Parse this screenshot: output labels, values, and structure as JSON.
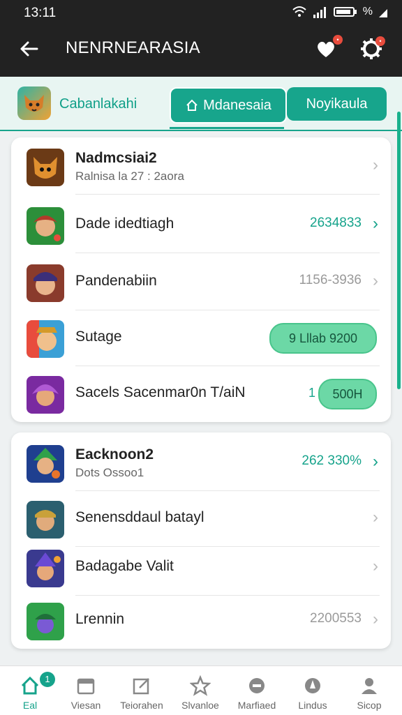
{
  "status": {
    "time": "13:11",
    "battery": "%"
  },
  "appbar": {
    "title": "NENRNEARASIA"
  },
  "tabs": {
    "brand_label": "Cabanlakahi",
    "tab1": "Mdanesaia",
    "tab2": "Noyikaula"
  },
  "card1": {
    "rows": [
      {
        "name": "Nadmcsiai2",
        "sub": "Ralnisa la 27 : 2aora",
        "icon": "fox-avatar-icon"
      },
      {
        "name": "Dade idedtiagh",
        "value": "2634833",
        "icon": "ranger-avatar-icon"
      },
      {
        "name": "Pandenabiin",
        "value": "1156-3936",
        "icon": "character-avatar-icon"
      },
      {
        "name": "Sutage",
        "pill": "9 Lllab 9200",
        "icon": "hero-avatar-icon"
      },
      {
        "name": "Sacels Sacenmar0n T/aiN",
        "prefix": "1",
        "pill": "500H",
        "icon": "mage-avatar-icon"
      }
    ]
  },
  "card2": {
    "rows": [
      {
        "name": "Eacknoon2",
        "sub": "Dots Ossoo1",
        "value": "262 330%",
        "icon": "archer-avatar-icon"
      },
      {
        "name": "Senensddaul batayl",
        "icon": "warrior-avatar-icon"
      },
      {
        "name": "Badagabe Valit",
        "icon": "wizard-avatar-icon"
      },
      {
        "name": "Lrennin",
        "value": "2200553",
        "icon": "elf-avatar-icon"
      }
    ]
  },
  "nav": {
    "items": [
      {
        "label": "Eal",
        "badge": "1"
      },
      {
        "label": "Viesan"
      },
      {
        "label": "Teiorahen"
      },
      {
        "label": "Slvanloe"
      },
      {
        "label": "Marfiaed"
      },
      {
        "label": "Lindus"
      },
      {
        "label": "Sicop"
      }
    ]
  },
  "colors": {
    "accent": "#16a38b",
    "dark": "#222222",
    "badge": "#e84c3d"
  }
}
